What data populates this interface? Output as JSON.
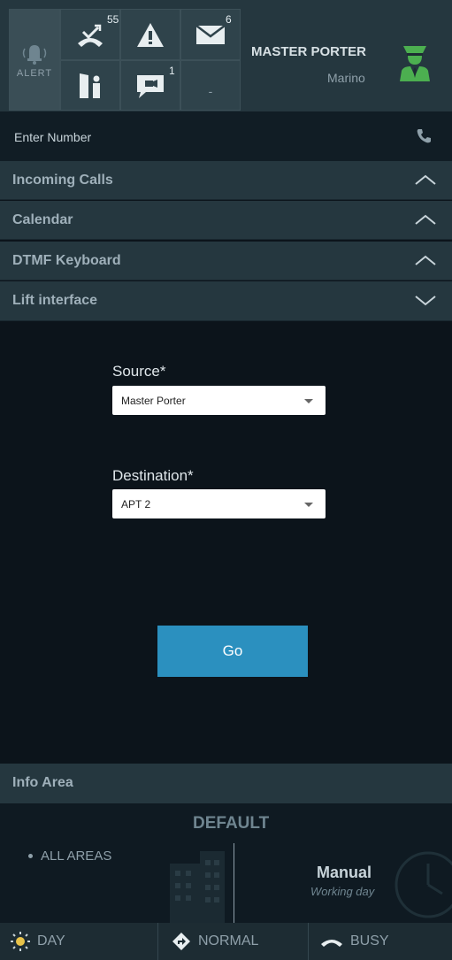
{
  "header": {
    "alert_label": "ALERT",
    "missed_calls_count": "55",
    "messages_count": "6",
    "chat_count": "1",
    "empty_slot": "-",
    "user_name": "MASTER PORTER",
    "user_sub": "Marino",
    "accent_green": "#4caf50"
  },
  "dial": {
    "placeholder": "Enter Number"
  },
  "accordion": [
    {
      "label": "Incoming Calls",
      "state": "collapsed"
    },
    {
      "label": "Calendar",
      "state": "collapsed"
    },
    {
      "label": "DTMF Keyboard",
      "state": "collapsed"
    },
    {
      "label": "Lift interface",
      "state": "expanded"
    }
  ],
  "lift": {
    "source_label": "Source*",
    "source_value": "Master Porter",
    "destination_label": "Destination*",
    "destination_value": "APT 2",
    "go_label": "Go",
    "button_color": "#2b90bf"
  },
  "info": {
    "title": "Info Area",
    "mode": "DEFAULT",
    "area": "ALL AREAS",
    "schedule_mode": "Manual",
    "schedule_sub": "Working day"
  },
  "bottom_bar": {
    "day_label": "DAY",
    "normal_label": "NORMAL",
    "busy_label": "BUSY"
  }
}
